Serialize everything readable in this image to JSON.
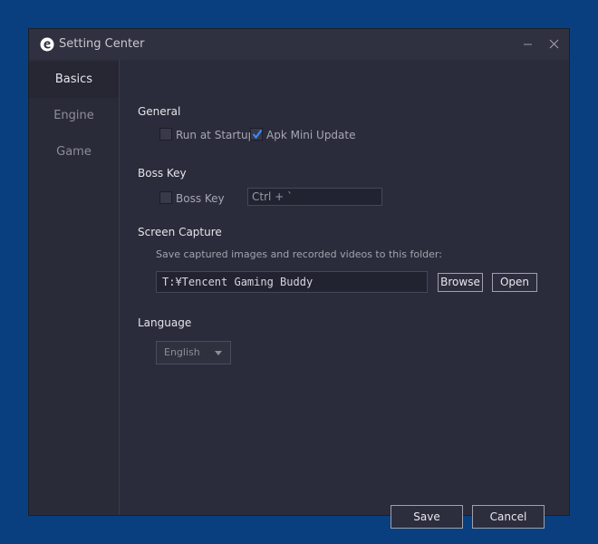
{
  "window": {
    "title": "Setting Center",
    "minimize_icon": "minimize-icon",
    "close_icon": "close-icon"
  },
  "sidebar": {
    "items": [
      {
        "label": "Basics",
        "active": true
      },
      {
        "label": "Engine",
        "active": false
      },
      {
        "label": "Game",
        "active": false
      }
    ]
  },
  "general": {
    "title": "General",
    "run_at_startup": {
      "label": "Run at Startup",
      "checked": false
    },
    "apk_mini_update": {
      "label": "Apk Mini Update",
      "checked": true
    }
  },
  "boss_key": {
    "title": "Boss Key",
    "checkbox": {
      "label": "Boss Key",
      "checked": false
    },
    "shortcut_value": "Ctrl + `"
  },
  "screen_capture": {
    "title": "Screen Capture",
    "description": "Save captured images and recorded videos to this folder:",
    "folder_path": "T:¥Tencent Gaming Buddy",
    "browse_label": "Browse",
    "open_label": "Open"
  },
  "language": {
    "title": "Language",
    "selected": "English"
  },
  "footer": {
    "save_label": "Save",
    "cancel_label": "Cancel"
  },
  "colors": {
    "background": "#0a3f7f",
    "window": "#2b2c3b",
    "accent_check": "#3c8cff"
  }
}
